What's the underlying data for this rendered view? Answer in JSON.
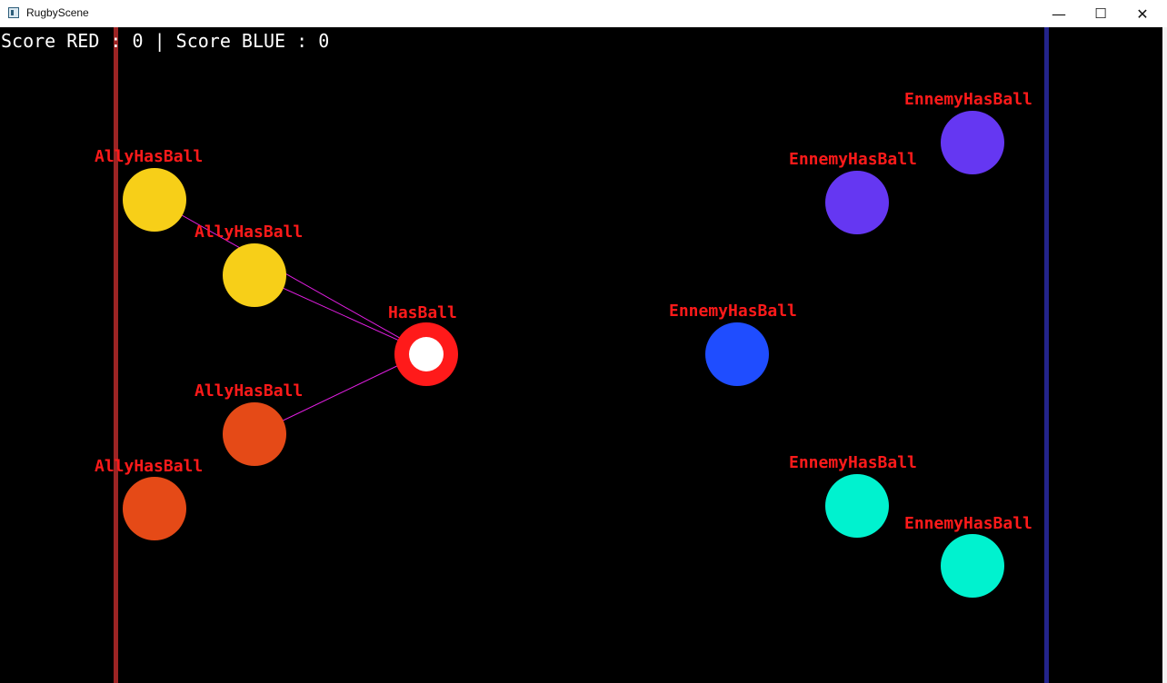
{
  "window": {
    "title": "RugbyScene",
    "controls": {
      "minimize": "—",
      "maximize": "☐",
      "close": "✕"
    }
  },
  "hud": {
    "score_text": "Score RED : 0 | Score BLUE : 0"
  },
  "colors": {
    "background": "#000000",
    "red_goal_line": "#9c2424",
    "blue_goal_line": "#23248c",
    "label": "#ff1a1a",
    "pass_line": "#e21ee2"
  },
  "players": [
    {
      "id": "ally-1",
      "team": "red",
      "state_label": "AllyHasBall",
      "color": "#f7cf18"
    },
    {
      "id": "ally-2",
      "team": "red",
      "state_label": "AllyHasBall",
      "color": "#f7cf18"
    },
    {
      "id": "ball-carrier",
      "team": "red",
      "state_label": "HasBall",
      "color": "#ff1a1a",
      "has_ball": true
    },
    {
      "id": "ally-3",
      "team": "red",
      "state_label": "AllyHasBall",
      "color": "#e54a17"
    },
    {
      "id": "ally-4",
      "team": "red",
      "state_label": "AllyHasBall",
      "color": "#e54a17"
    },
    {
      "id": "enemy-1",
      "team": "blue",
      "state_label": "EnnemyHasBall",
      "color": "#6537f2"
    },
    {
      "id": "enemy-2",
      "team": "blue",
      "state_label": "EnnemyHasBall",
      "color": "#6537f2"
    },
    {
      "id": "enemy-3",
      "team": "blue",
      "state_label": "EnnemyHasBall",
      "color": "#1f4dff"
    },
    {
      "id": "enemy-4",
      "team": "blue",
      "state_label": "EnnemyHasBall",
      "color": "#00f2cf"
    },
    {
      "id": "enemy-5",
      "team": "blue",
      "state_label": "EnnemyHasBall",
      "color": "#00f2cf"
    }
  ]
}
